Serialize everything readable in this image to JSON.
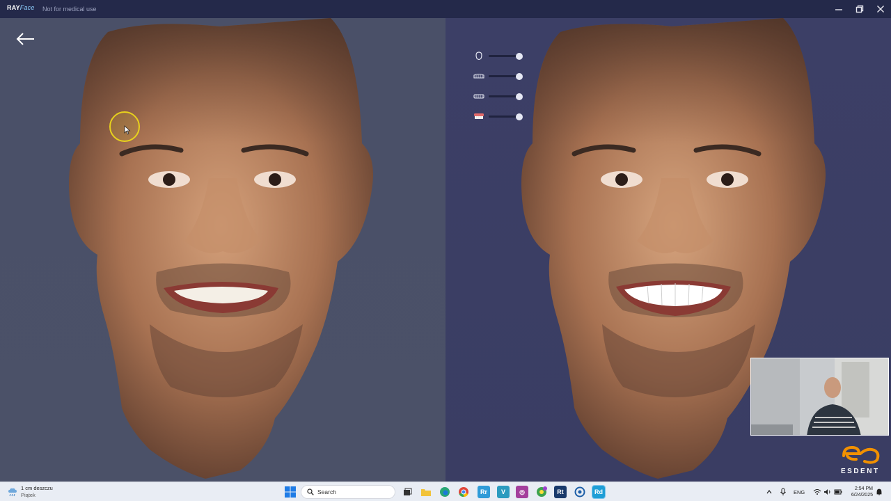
{
  "app": {
    "brand_main": "RAY",
    "brand_face": "Face",
    "subtitle": "Not for medical use"
  },
  "window_controls": [
    "minimize-icon",
    "restore-icon",
    "close-icon"
  ],
  "left_view": {
    "back_icon": "arrow-left-icon"
  },
  "right_view": {
    "sliders": [
      {
        "icon": "face-outline-icon",
        "value": 1.0
      },
      {
        "icon": "upper-teeth-icon",
        "value": 1.0
      },
      {
        "icon": "lower-teeth-icon",
        "value": 1.0
      },
      {
        "icon": "smile-design-icon",
        "value": 1.0
      }
    ]
  },
  "brand_overlay": {
    "logo": "esdent-logo",
    "label": "ESDENT"
  },
  "taskbar": {
    "weather_temp": "1 cm deszczu",
    "weather_day": "Piątek",
    "search_label": "Search",
    "lang": "ENG",
    "time": "2:54 PM",
    "date": "6/24/2025",
    "apps": [
      "task-view-icon",
      "file-explorer-icon",
      "edge-icon",
      "chrome-icon",
      "rayface-icon",
      "vectorworks-icon",
      "camera-app-icon",
      "browser-app-icon",
      "rt-app-icon",
      "settings-app-icon",
      "rd-app-icon"
    ]
  },
  "colors": {
    "title_bar": "#24294a",
    "left_bg": "#4a5068",
    "right_bg": "#3c3f66",
    "cursor_ring": "#e8d21c",
    "esdent_orange": "#f29100"
  }
}
